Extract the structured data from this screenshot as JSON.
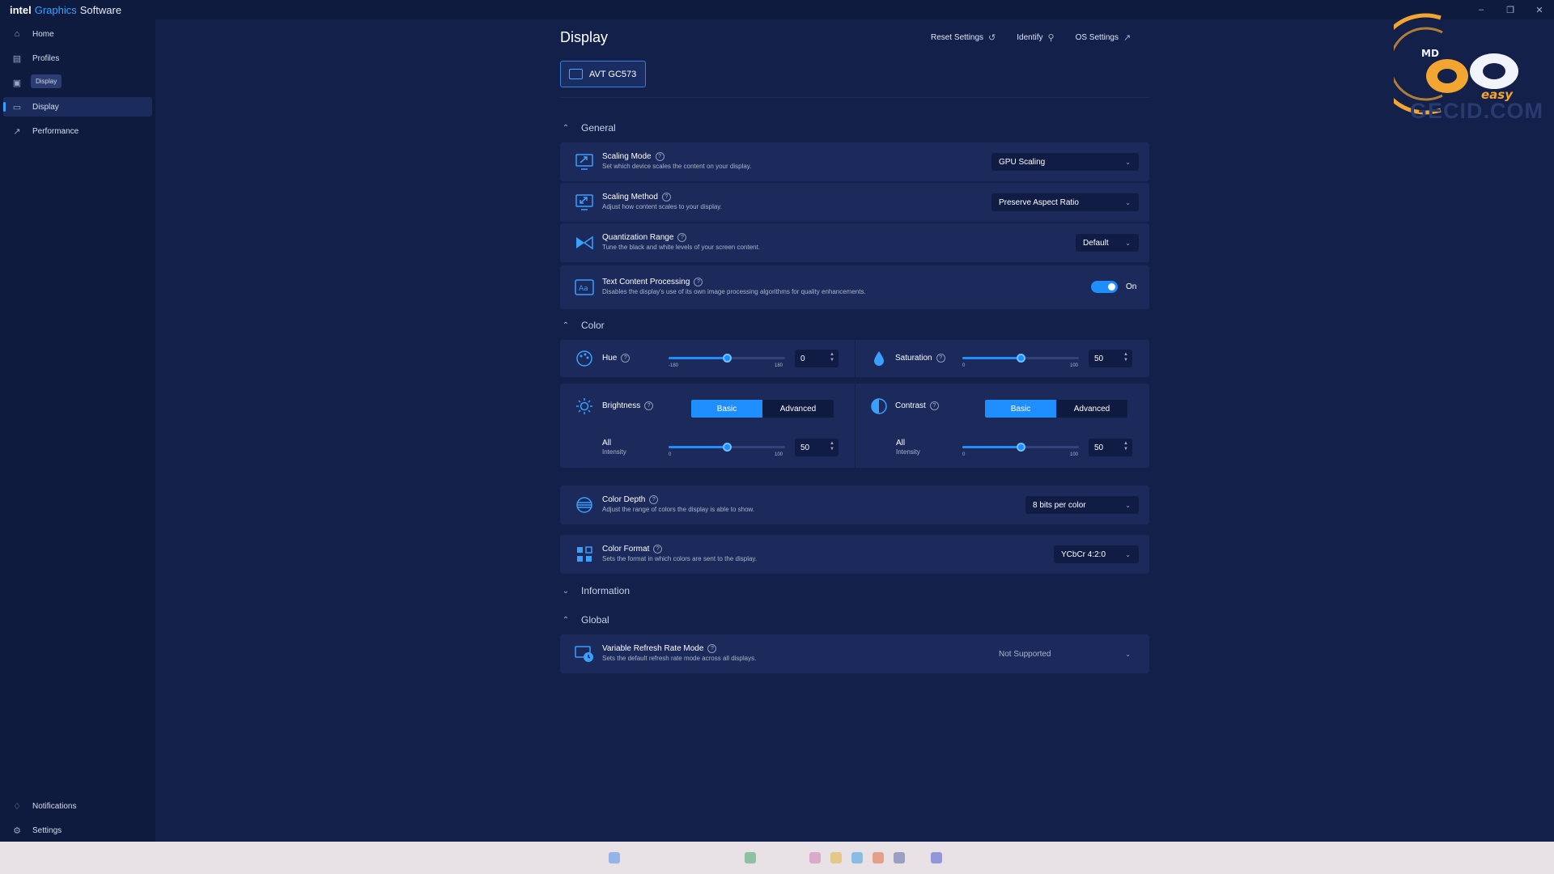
{
  "app": {
    "title_brand": "intel",
    "title_accent": "Graphics",
    "title_rest": "Software"
  },
  "sidebar": {
    "items": [
      {
        "label": "Home",
        "icon": "home-icon"
      },
      {
        "label": "Profiles",
        "icon": "profiles-icon"
      },
      {
        "label": "Display",
        "icon": "display-icon"
      },
      {
        "label": "Performance",
        "icon": "performance-icon"
      }
    ],
    "tooltip": "Display",
    "bottom_items": [
      {
        "label": "Notifications",
        "icon": "bell-icon"
      },
      {
        "label": "Settings",
        "icon": "gear-icon"
      }
    ]
  },
  "header": {
    "title": "Display",
    "reset_label": "Reset Settings",
    "identify_label": "Identify",
    "os_settings_label": "OS Settings",
    "monitor_label": "AVT GC573"
  },
  "sections": {
    "general": "General",
    "color": "Color",
    "information": "Information",
    "global": "Global"
  },
  "general": {
    "scaling_mode": {
      "title": "Scaling Mode",
      "desc": "Set which device scales the content on your display.",
      "value": "GPU Scaling"
    },
    "scaling_method": {
      "title": "Scaling Method",
      "desc": "Adjust how content scales to your display.",
      "value": "Preserve Aspect Ratio"
    },
    "quantization": {
      "title": "Quantization Range",
      "desc": "Tune the black and white levels of your screen content.",
      "value": "Default"
    },
    "text_processing": {
      "title": "Text Content Processing",
      "desc": "Disables the display's use of its own image processing algorithms for quality enhancements.",
      "state": "On"
    }
  },
  "color": {
    "hue": {
      "title": "Hue",
      "value": "0",
      "min": "-180",
      "max": "180",
      "level": 0.5
    },
    "saturation": {
      "title": "Saturation",
      "value": "50",
      "min": "0",
      "max": "100",
      "level": 0.5
    },
    "brightness": {
      "title": "Brightness",
      "basic": "Basic",
      "advanced": "Advanced",
      "channel": "All",
      "sub": "Intensity",
      "value": "50",
      "min": "0",
      "max": "100",
      "level": 0.5
    },
    "contrast": {
      "title": "Contrast",
      "basic": "Basic",
      "advanced": "Advanced",
      "channel": "All",
      "sub": "Intensity",
      "value": "50",
      "min": "0",
      "max": "100",
      "level": 0.5
    },
    "depth": {
      "title": "Color Depth",
      "desc": "Adjust the range of colors the display is able to show.",
      "value": "8 bits per color"
    },
    "format": {
      "title": "Color Format",
      "desc": "Sets the format in which colors are sent to the display.",
      "value": "YCbCr 4:2:0"
    }
  },
  "global": {
    "vrr": {
      "title": "Variable Refresh Rate Mode",
      "desc": "Sets the default refresh rate mode across all displays.",
      "value": "Not Supported"
    }
  },
  "watermark": {
    "logo_text": "easy",
    "logo_small": "MD",
    "site": "GECID.COM"
  },
  "colors": {
    "accent": "#1f8fff",
    "background": "#13204a",
    "sidebar": "#0f1b3e",
    "card": "#1b2a5a"
  }
}
